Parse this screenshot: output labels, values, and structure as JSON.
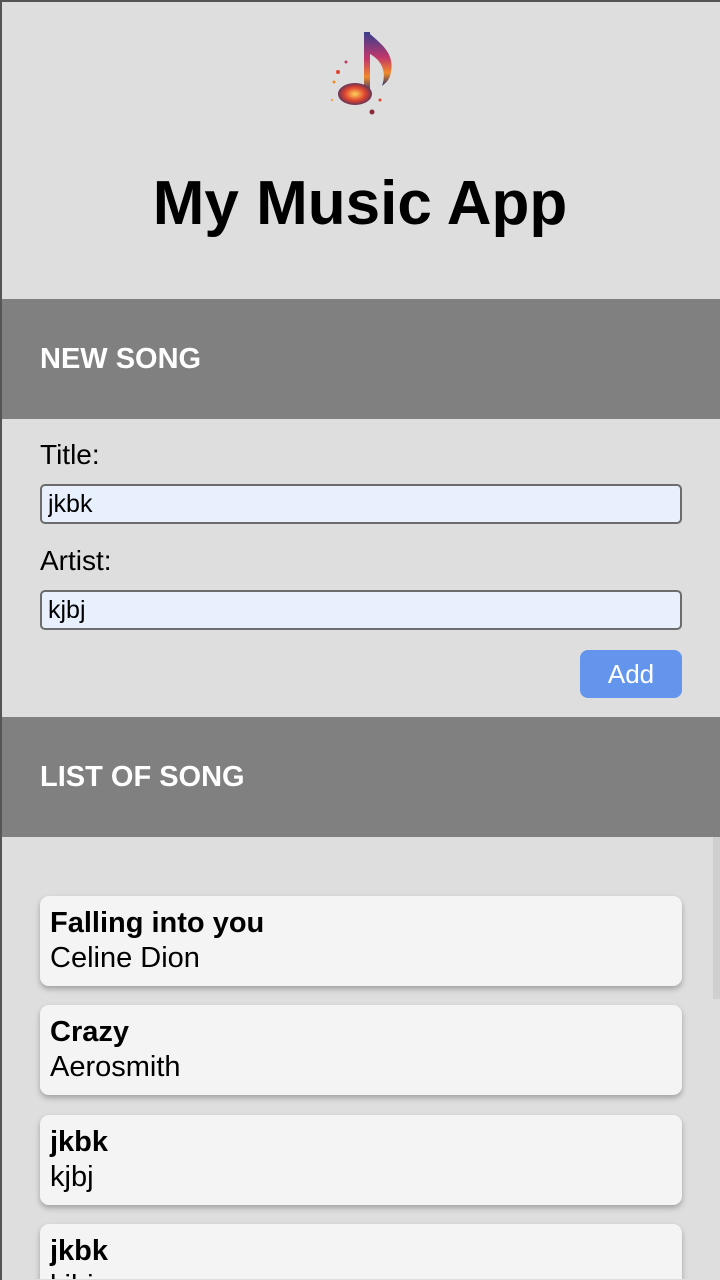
{
  "app": {
    "title": "My Music App",
    "logo_icon": "music-note-icon"
  },
  "new_song": {
    "heading": "NEW SONG",
    "title_label": "Title:",
    "title_value": "jkbk",
    "artist_label": "Artist:",
    "artist_value": "kjbj",
    "add_label": "Add"
  },
  "song_list": {
    "heading": "LIST OF SONG",
    "items": [
      {
        "title": "Falling into you",
        "artist": "Celine Dion"
      },
      {
        "title": "Crazy",
        "artist": "Aerosmith"
      },
      {
        "title": "jkbk",
        "artist": "kjbj"
      },
      {
        "title": "jkbk",
        "artist": "kjbj"
      }
    ]
  },
  "colors": {
    "background": "#dedede",
    "section_bar": "#808080",
    "add_button": "#6495ed",
    "input_bg": "#e8f0fe"
  }
}
